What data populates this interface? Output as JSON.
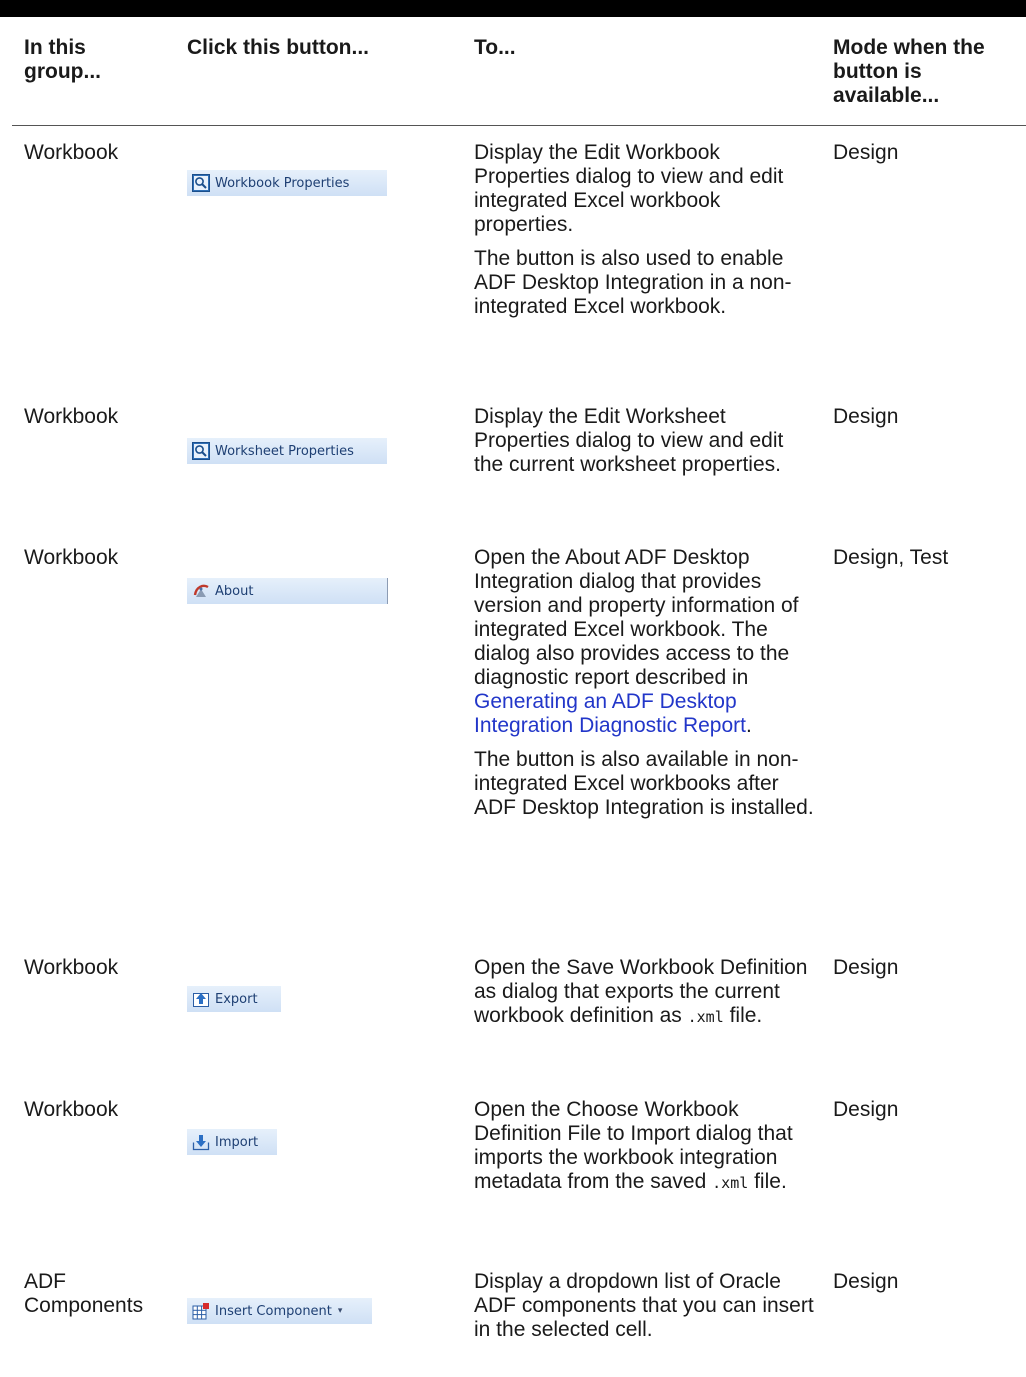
{
  "headers": {
    "group": "In this group...",
    "button": "Click this button...",
    "to": "To...",
    "mode": "Mode when the button is available..."
  },
  "rows": [
    {
      "group": "Workbook",
      "button": {
        "label": "Workbook Properties",
        "icon": "magnifier-icon"
      },
      "desc": [
        "Display the Edit Workbook Properties dialog to view and edit integrated Excel workbook properties.",
        "The button is also used to enable ADF Desktop Integration in a non-integrated Excel workbook."
      ],
      "mode": "Design"
    },
    {
      "group": "Workbook",
      "button": {
        "label": "Worksheet Properties",
        "icon": "magnifier-icon"
      },
      "desc": [
        "Display the Edit Worksheet Properties dialog to view and edit the current worksheet properties."
      ],
      "mode": "Design"
    },
    {
      "group": "Workbook",
      "button": {
        "label": "About",
        "icon": "about-logo-icon"
      },
      "desc": {
        "p1_before_link": "Open the About ADF Desktop Integration dialog that provides version and property information of integrated Excel workbook. The dialog also provides access to the diagnostic report described in ",
        "p1_link": "Generating an ADF Desktop Integration Diagnostic Report",
        "p1_after_link": ".",
        "p2": "The button is also available in non-integrated Excel workbooks after ADF Desktop Integration is installed."
      },
      "mode": "Design, Test"
    },
    {
      "group": "Workbook",
      "button": {
        "label": "Export",
        "icon": "export-arrow-icon"
      },
      "desc": {
        "before_code": "Open the Save Workbook Definition as dialog that exports the current workbook definition as ",
        "code": ".xml",
        "after_code": " file."
      },
      "mode": "Design"
    },
    {
      "group": "Workbook",
      "button": {
        "label": "Import",
        "icon": "import-arrow-icon"
      },
      "desc": {
        "before_code": "Open the Choose Workbook Definition File to Import dialog that imports the workbook integration metadata from the saved ",
        "code": ".xml",
        "after_code": " file."
      },
      "mode": "Design"
    },
    {
      "group": "ADF Components",
      "button": {
        "label": "Insert Component",
        "icon": "insert-component-icon",
        "dropdown": "▾"
      },
      "desc": [
        "Display a dropdown list of Oracle ADF components that you can insert in the selected cell."
      ],
      "mode": "Design"
    }
  ],
  "colors": {
    "link": "#2236c9",
    "ribbon_button": "#cfe0f5",
    "ribbon_text": "#1e3f73"
  }
}
